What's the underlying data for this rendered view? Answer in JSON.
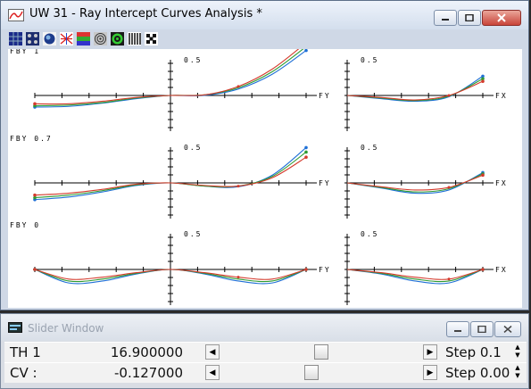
{
  "window": {
    "title": "UW 31 - Ray Intercept Curves Analysis *",
    "toolbar_icons": [
      "grid-pattern-icon",
      "dots-pattern-icon",
      "spot-icon",
      "ray-fan-icon",
      "multicolor-grid-icon",
      "circles-pattern-icon",
      "target-icon",
      "bars-pattern-icon",
      "checker-icon"
    ]
  },
  "chart_data": [
    {
      "type": "line",
      "title": "FBY 1",
      "subtitle": "0.5",
      "xlabel": "FY",
      "x": [
        -1,
        -0.75,
        -0.5,
        -0.25,
        0,
        0.25,
        0.5,
        0.75,
        1
      ],
      "ylim": [
        -0.5,
        0.5
      ],
      "series": [
        {
          "color": "#1e6fd6",
          "values": [
            -0.18,
            -0.17,
            -0.12,
            -0.05,
            0,
            0.0,
            0.1,
            0.33,
            0.7
          ]
        },
        {
          "color": "#2e9b32",
          "values": [
            -0.16,
            -0.15,
            -0.11,
            -0.04,
            0,
            0.01,
            0.12,
            0.37,
            0.76
          ]
        },
        {
          "color": "#d43a2c",
          "values": [
            -0.13,
            -0.13,
            -0.09,
            -0.03,
            0,
            0.01,
            0.14,
            0.41,
            0.82
          ]
        }
      ]
    },
    {
      "type": "line",
      "title": "",
      "subtitle": "0.5",
      "xlabel": "FX",
      "x": [
        0,
        0.25,
        0.5,
        0.75,
        1
      ],
      "ylim": [
        -0.5,
        0.5
      ],
      "series": [
        {
          "color": "#1e6fd6",
          "values": [
            0,
            -0.05,
            -0.09,
            -0.02,
            0.3
          ]
        },
        {
          "color": "#2e9b32",
          "values": [
            0,
            -0.04,
            -0.08,
            -0.01,
            0.26
          ]
        },
        {
          "color": "#d43a2c",
          "values": [
            0,
            -0.03,
            -0.07,
            0.0,
            0.22
          ]
        }
      ]
    },
    {
      "type": "line",
      "title": "FBY 0.7",
      "subtitle": "0.5",
      "xlabel": "FY",
      "x": [
        -1,
        -0.75,
        -0.5,
        -0.25,
        0,
        0.25,
        0.5,
        0.75,
        1
      ],
      "ylim": [
        -0.5,
        0.5
      ],
      "series": [
        {
          "color": "#1e6fd6",
          "values": [
            -0.26,
            -0.22,
            -0.14,
            -0.04,
            0,
            -0.05,
            -0.06,
            0.12,
            0.55
          ]
        },
        {
          "color": "#2e9b32",
          "values": [
            -0.23,
            -0.19,
            -0.12,
            -0.03,
            0,
            -0.05,
            -0.05,
            0.1,
            0.48
          ]
        },
        {
          "color": "#d43a2c",
          "values": [
            -0.19,
            -0.16,
            -0.1,
            -0.02,
            0,
            -0.04,
            -0.05,
            0.08,
            0.4
          ]
        }
      ]
    },
    {
      "type": "line",
      "title": "",
      "subtitle": "0.5",
      "xlabel": "FX",
      "x": [
        0,
        0.25,
        0.5,
        0.75,
        1
      ],
      "ylim": [
        -0.5,
        0.5
      ],
      "series": [
        {
          "color": "#1e6fd6",
          "values": [
            0,
            -0.08,
            -0.16,
            -0.11,
            0.16
          ]
        },
        {
          "color": "#2e9b32",
          "values": [
            0,
            -0.07,
            -0.14,
            -0.09,
            0.14
          ]
        },
        {
          "color": "#d43a2c",
          "values": [
            0,
            -0.06,
            -0.11,
            -0.07,
            0.12
          ]
        }
      ]
    },
    {
      "type": "line",
      "title": "FBY 0",
      "subtitle": "0.5",
      "xlabel": "FY",
      "x": [
        -1,
        -0.75,
        -0.5,
        -0.25,
        0,
        0.25,
        0.5,
        0.75,
        1
      ],
      "ylim": [
        -0.5,
        0.5
      ],
      "series": [
        {
          "color": "#1e6fd6",
          "values": [
            0,
            -0.21,
            -0.18,
            -0.07,
            0,
            -0.07,
            -0.18,
            -0.21,
            0
          ]
        },
        {
          "color": "#2e9b32",
          "values": [
            0,
            -0.18,
            -0.15,
            -0.06,
            0,
            -0.06,
            -0.15,
            -0.18,
            0
          ]
        },
        {
          "color": "#d43a2c",
          "values": [
            0,
            -0.15,
            -0.12,
            -0.05,
            0,
            -0.05,
            -0.12,
            -0.15,
            0
          ]
        }
      ]
    },
    {
      "type": "line",
      "title": "",
      "subtitle": "0.5",
      "xlabel": "FX",
      "x": [
        0,
        0.25,
        0.5,
        0.75,
        1
      ],
      "ylim": [
        -0.5,
        0.5
      ],
      "series": [
        {
          "color": "#1e6fd6",
          "values": [
            0,
            -0.07,
            -0.18,
            -0.21,
            0
          ]
        },
        {
          "color": "#2e9b32",
          "values": [
            0,
            -0.06,
            -0.15,
            -0.18,
            0
          ]
        },
        {
          "color": "#d43a2c",
          "values": [
            0,
            -0.05,
            -0.12,
            -0.15,
            0
          ]
        }
      ]
    }
  ],
  "slider_window": {
    "title": "Slider Window",
    "rows": [
      {
        "label": "TH 1",
        "value": "16.900000",
        "position": 0.5,
        "step": "Step 0.1"
      },
      {
        "label": "CV :",
        "value": "-0.127000",
        "position": 0.45,
        "step": "Step 0.00"
      }
    ]
  }
}
